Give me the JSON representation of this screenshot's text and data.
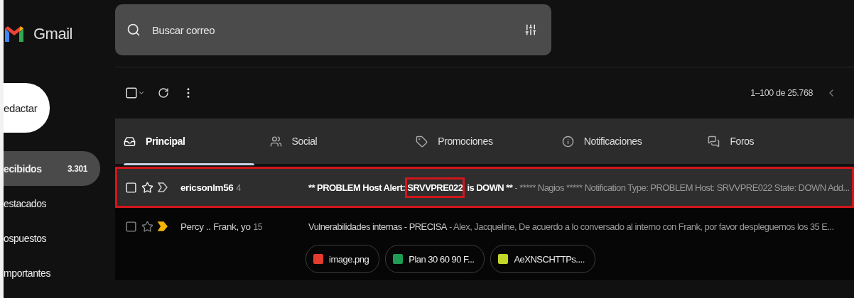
{
  "logo": {
    "text": "Gmail"
  },
  "compose": {
    "label": "edactar"
  },
  "sidebar": {
    "items": [
      {
        "label": "ecibidos",
        "count": "3.301",
        "selected": true
      },
      {
        "label": "estacados",
        "selected": false
      },
      {
        "label": "ospuestos",
        "selected": false
      },
      {
        "label": "mportantes",
        "selected": false
      }
    ]
  },
  "search": {
    "placeholder": "Buscar correo"
  },
  "toolbar": {
    "select_all_checked": false,
    "pagination": "1–100 de 25.768"
  },
  "tabs": [
    {
      "label": "Principal",
      "selected": true
    },
    {
      "label": "Social",
      "selected": false
    },
    {
      "label": "Promociones",
      "selected": false
    },
    {
      "label": "Notificaciones",
      "selected": false
    },
    {
      "label": "Foros",
      "selected": false
    }
  ],
  "emails": [
    {
      "sender": "ericsonlm56",
      "count": "4",
      "unread": true,
      "starred": false,
      "important": false,
      "highlighted": true,
      "subject": [
        {
          "text": "** PROBLEM Host Alert: ",
          "highlighted": false
        },
        {
          "text": "SRVVPRE022",
          "highlighted": true
        },
        {
          "text": " is DOWN **",
          "highlighted": false
        }
      ],
      "snippet": " - ***** Nagios ***** Notification Type: PROBLEM Host: SRVVPRE022 State: DOWN Add..."
    },
    {
      "sender": "Percy .. Frank, yo",
      "count": "15",
      "unread": false,
      "starred": false,
      "important": true,
      "highlighted": false,
      "subject": [
        {
          "text": "Vulnerabilidades internas - PRECISA",
          "highlighted": false
        }
      ],
      "snippet": " - Alex, Jacqueline, De acuerdo a lo conversado al interno con Frank, por favor despleguemos los 35 E...",
      "attachments": [
        {
          "kind": "image",
          "name": "image.png"
        },
        {
          "kind": "sheet",
          "name": "Plan 30 60 90 F..."
        },
        {
          "kind": "file",
          "name": "AeXNSCHTTPs...."
        }
      ]
    }
  ]
}
